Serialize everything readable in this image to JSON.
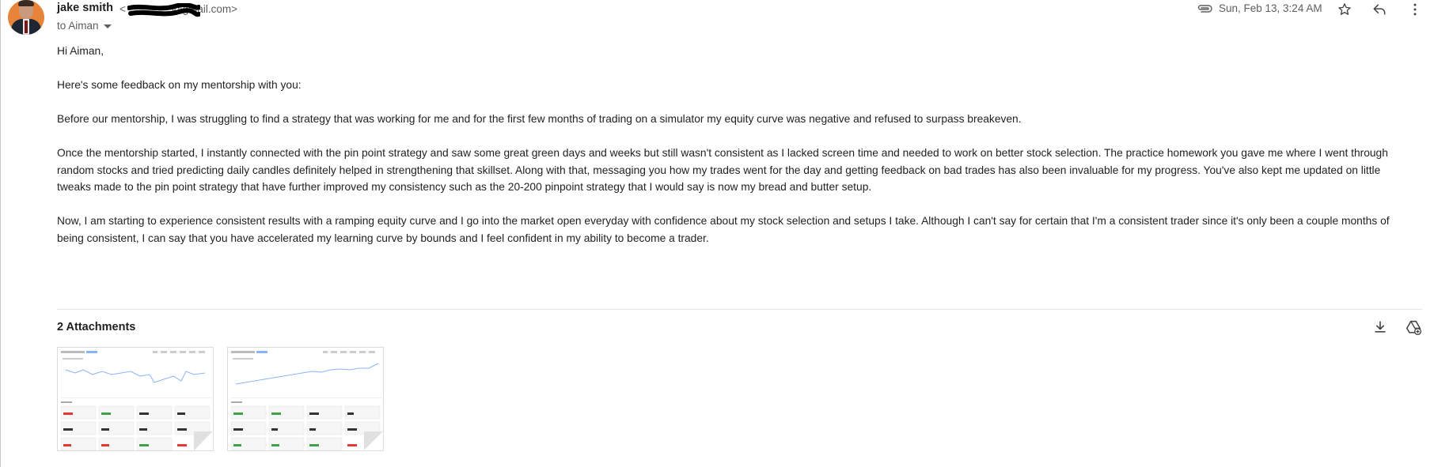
{
  "message": {
    "sender_name": "jake smith",
    "sender_email_tail": "@gmail.com>",
    "sender_email_open": "<",
    "recipient_label": "to Aiman",
    "date": "Sun, Feb 13, 3:24 AM"
  },
  "icons": {
    "attachment": "paperclip-icon",
    "star": "star-icon",
    "reply": "reply-icon",
    "more": "more-vert-icon",
    "download": "download-icon",
    "drive": "add-to-drive-icon"
  },
  "body": {
    "greeting": "Hi Aiman,",
    "p1": "Here's some feedback on my mentorship with you:",
    "p2": "Before our mentorship, I was struggling to find a strategy that was working for me and for the first few months of trading on a simulator my equity curve was negative and refused to surpass breakeven.",
    "p3": "Once the mentorship started, I instantly connected with the pin point strategy and saw some great green days and weeks but still wasn't consistent as I lacked screen time and needed to work on better stock selection. The practice homework you gave me where I went through random stocks and tried predicting daily candles definitely helped in strengthening that skillset. Along with that, messaging you how my trades went for the day and getting feedback on bad trades has also been invaluable for my progress. You've also kept me updated on little tweaks made to the pin point strategy that have further improved my consistency such as the 20-200 pinpoint strategy that I would say is now my bread and butter setup.",
    "p4": "Now, I am starting to experience consistent results with a ramping equity curve and I go into the market open everyday with confidence about my stock selection and setups I take. Although I can't say for certain that I'm a consistent trader since it's only been a couple months of being consistent, I can say that you have accelerated my learning curve by bounds and I feel confident in my ability to become a trader."
  },
  "attachments": {
    "title": "2 Attachments",
    "items": [
      {
        "kind": "image-thumbnail",
        "accent": "#e53935"
      },
      {
        "kind": "image-thumbnail",
        "accent": "#43a047"
      }
    ]
  },
  "colors": {
    "text": "#202124",
    "muted": "#5e5e5e",
    "divider": "#e3e3e3",
    "chart_line": "#8ab4f8"
  }
}
